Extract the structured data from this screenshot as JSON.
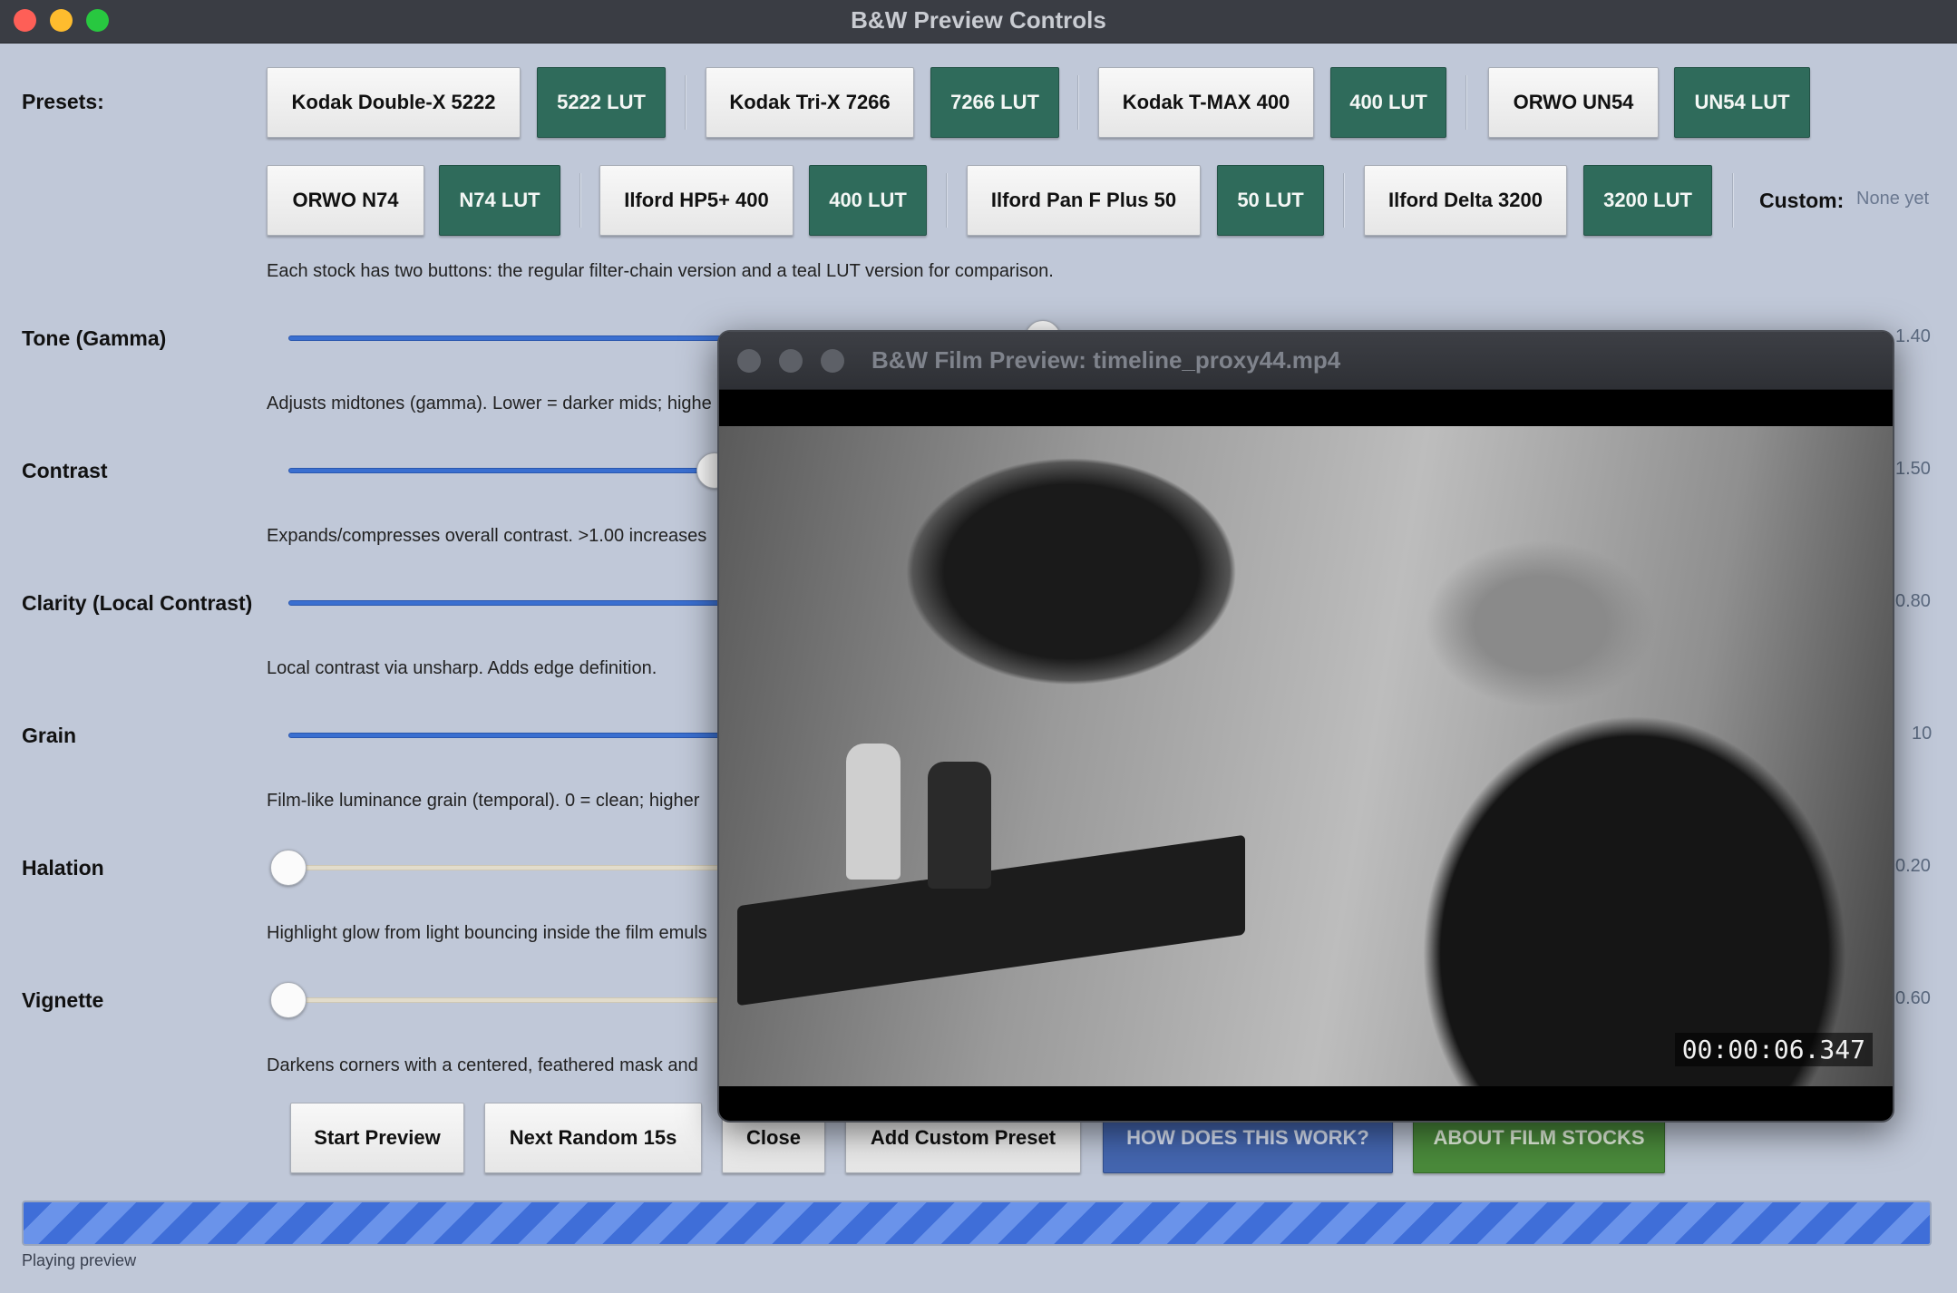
{
  "app": {
    "title": "B&W Preview Controls"
  },
  "presets": {
    "label": "Presets:",
    "row1": [
      {
        "name": "Kodak Double-X 5222",
        "lut": "5222 LUT"
      },
      {
        "name": "Kodak Tri-X 7266",
        "lut": "7266 LUT"
      },
      {
        "name": "Kodak T-MAX 400",
        "lut": "400 LUT"
      },
      {
        "name": "ORWO UN54",
        "lut": "UN54 LUT"
      }
    ],
    "row2": [
      {
        "name": "ORWO N74",
        "lut": "N74 LUT"
      },
      {
        "name": "Ilford HP5+ 400",
        "lut": "400 LUT"
      },
      {
        "name": "Ilford Pan F Plus 50",
        "lut": "50 LUT"
      },
      {
        "name": "Ilford Delta 3200",
        "lut": "3200 LUT"
      }
    ],
    "custom_label": "Custom:",
    "custom_value": "None yet",
    "hint": "Each stock has two buttons: the regular filter-chain version and a teal LUT version for comparison."
  },
  "sliders": [
    {
      "label": "Tone (Gamma)",
      "value": "1.40",
      "desc": "Adjusts midtones (gamma). Lower = darker mids; highe"
    },
    {
      "label": "Contrast",
      "value": "1.50",
      "desc": "Expands/compresses overall contrast. >1.00 increases"
    },
    {
      "label": "Clarity (Local Contrast)",
      "value": "0.80",
      "desc": "Local contrast via unsharp. Adds edge definition."
    },
    {
      "label": "Grain",
      "value": "10",
      "desc": "Film-like luminance grain (temporal). 0 = clean; higher"
    },
    {
      "label": "Halation",
      "value": "0.20",
      "desc": "Highlight glow from light bouncing inside the film emuls"
    },
    {
      "label": "Vignette",
      "value": "0.60",
      "desc": "Darkens corners with a centered, feathered mask and"
    }
  ],
  "actions": {
    "start": "Start Preview",
    "next": "Next Random 15s",
    "close": "Close",
    "add_custom": "Add Custom Preset",
    "how": "HOW DOES THIS WORK?",
    "about": "ABOUT FILM STOCKS"
  },
  "status": "Playing preview",
  "preview": {
    "title": "B&W Film Preview: timeline_proxy44.mp4",
    "timecode": "00:00:06.347"
  }
}
